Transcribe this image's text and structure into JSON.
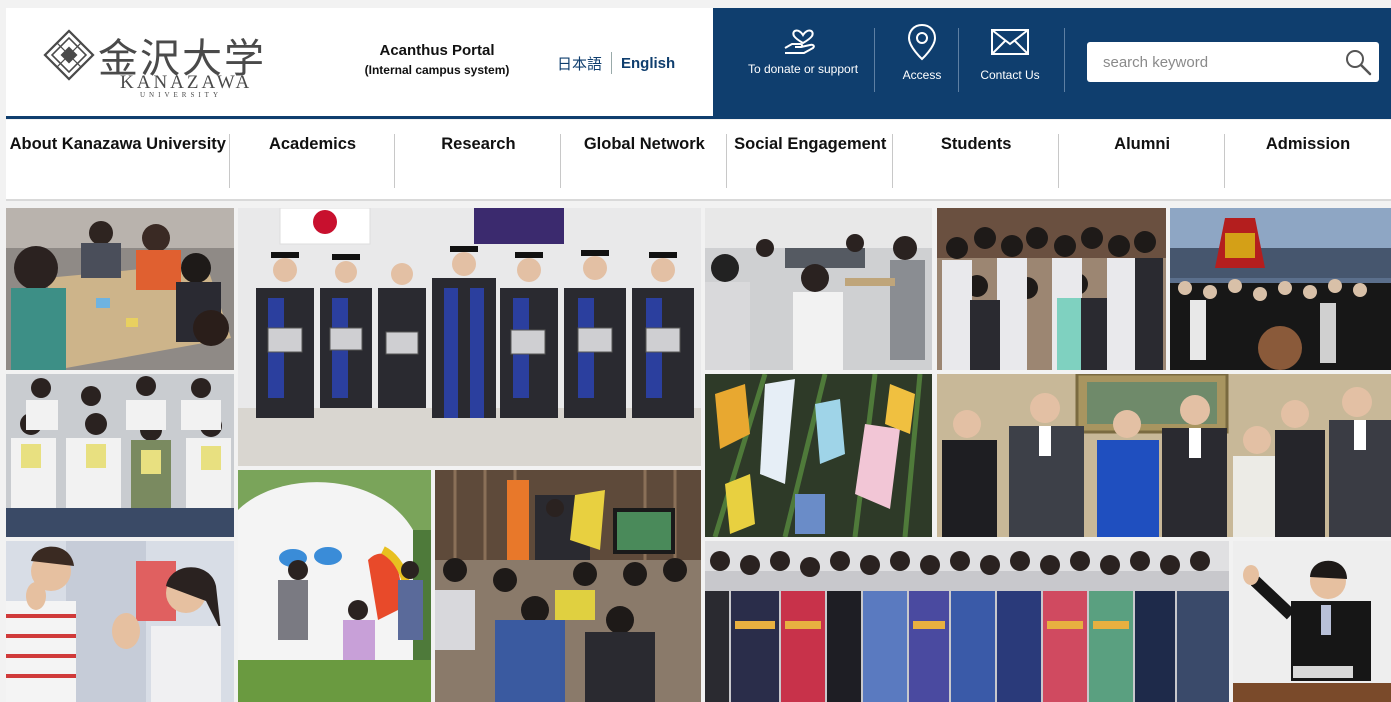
{
  "header": {
    "logo": {
      "kanji": "金沢大学",
      "roman": "KANAZAWA",
      "roman_sub": "UNIVERSITY",
      "emblem_icon": "university-emblem-icon"
    },
    "portal": {
      "title": "Acanthus Portal",
      "subtitle": "(Internal campus system)"
    },
    "language": {
      "japanese": "日本語",
      "english": "English"
    },
    "links": [
      {
        "label": "To donate or support",
        "icon": "heart-hand-icon"
      },
      {
        "label": "Access",
        "icon": "map-pin-icon"
      },
      {
        "label": "Contact Us",
        "icon": "envelope-icon"
      }
    ],
    "search": {
      "placeholder": "search keyword",
      "value": "",
      "icon": "search-icon"
    }
  },
  "nav": {
    "items": [
      "About Kanazawa University",
      "Academics",
      "Research",
      "Global Network",
      "Social Engagement",
      "Students",
      "Alumni",
      "Admission"
    ]
  },
  "colors": {
    "brand_navy": "#0f3e6e",
    "background": "#f2f2f2",
    "text": "#111111"
  },
  "photos": [
    {
      "subject": "students-group-workshop"
    },
    {
      "subject": "graduation-ceremony"
    },
    {
      "subject": "seminar-classroom"
    },
    {
      "subject": "group-photo-students"
    },
    {
      "subject": "festival-portable-shrine"
    },
    {
      "subject": "students-holding-cards"
    },
    {
      "subject": "tanabata-wishes"
    },
    {
      "subject": "officials-group-photo"
    },
    {
      "subject": "painting-inflatable-dome"
    },
    {
      "subject": "lecture-hall-event"
    },
    {
      "subject": "students-waving"
    },
    {
      "subject": "yukata-group-photo"
    },
    {
      "subject": "presenter-with-microphone"
    }
  ]
}
